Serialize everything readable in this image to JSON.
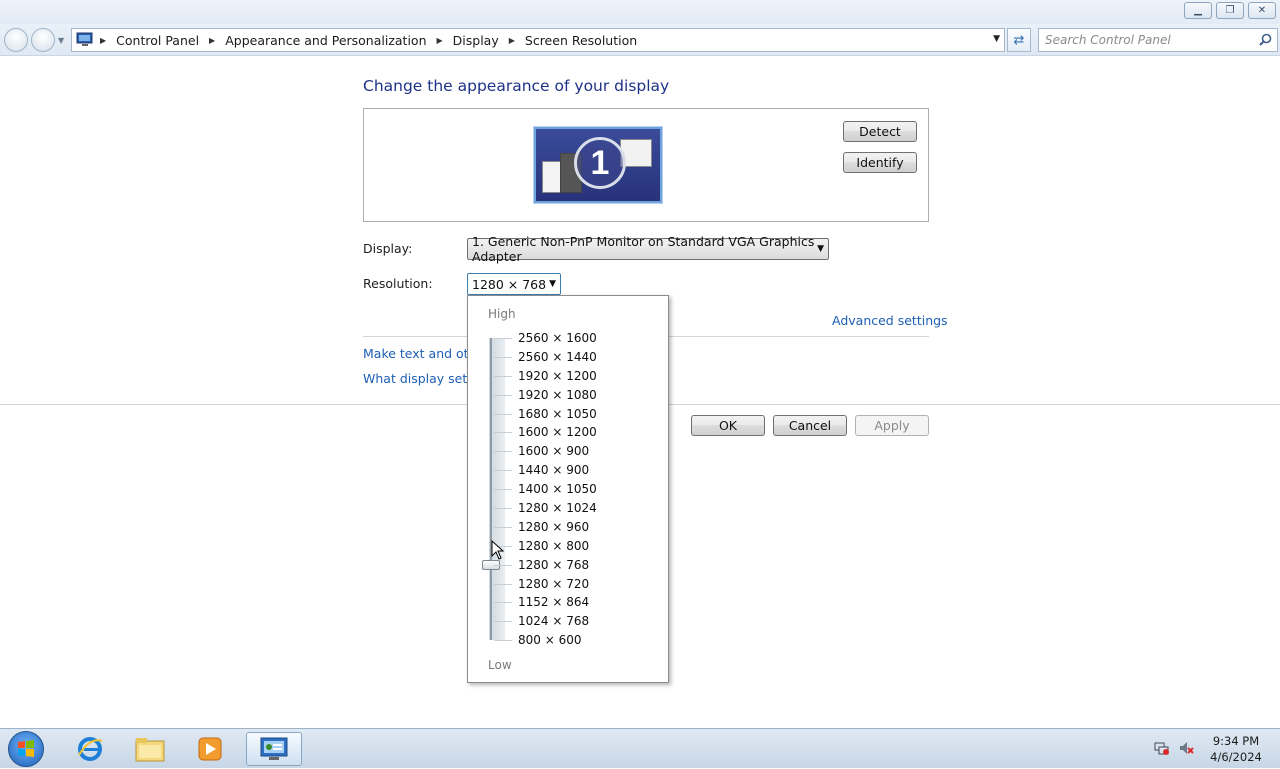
{
  "window": {
    "minimize_icon": "minimize-icon",
    "restore_icon": "restore-icon",
    "close_icon": "close-icon"
  },
  "address_bar": {
    "breadcrumbs": [
      "Control Panel",
      "Appearance and Personalization",
      "Display",
      "Screen Resolution"
    ]
  },
  "search": {
    "placeholder": "Search Control Panel"
  },
  "main": {
    "title": "Change the appearance of your display",
    "monitor_number": "1",
    "detect_label": "Detect",
    "identify_label": "Identify",
    "display_label": "Display:",
    "display_value": "1. Generic Non-PnP Monitor on Standard VGA Graphics Adapter",
    "resolution_label": "Resolution:",
    "resolution_value": "1280 × 768",
    "advanced_link": "Advanced settings",
    "text_size_link": "Make text and other",
    "which_settings_link": "What display setting",
    "ok_label": "OK",
    "cancel_label": "Cancel",
    "apply_label": "Apply"
  },
  "resolution_dropdown": {
    "high_label": "High",
    "low_label": "Low",
    "options": [
      "2560 × 1600",
      "2560 × 1440",
      "1920 × 1200",
      "1920 × 1080",
      "1680 × 1050",
      "1600 × 1200",
      "1600 × 900",
      "1440 × 900",
      "1400 × 1050",
      "1280 × 1024",
      "1280 × 960",
      "1280 × 800",
      "1280 × 768",
      "1280 × 720",
      "1152 × 864",
      "1024 × 768",
      "800 × 600"
    ],
    "selected": "1280 × 768"
  },
  "taskbar": {
    "time": "9:34 PM",
    "date": "4/6/2024"
  }
}
